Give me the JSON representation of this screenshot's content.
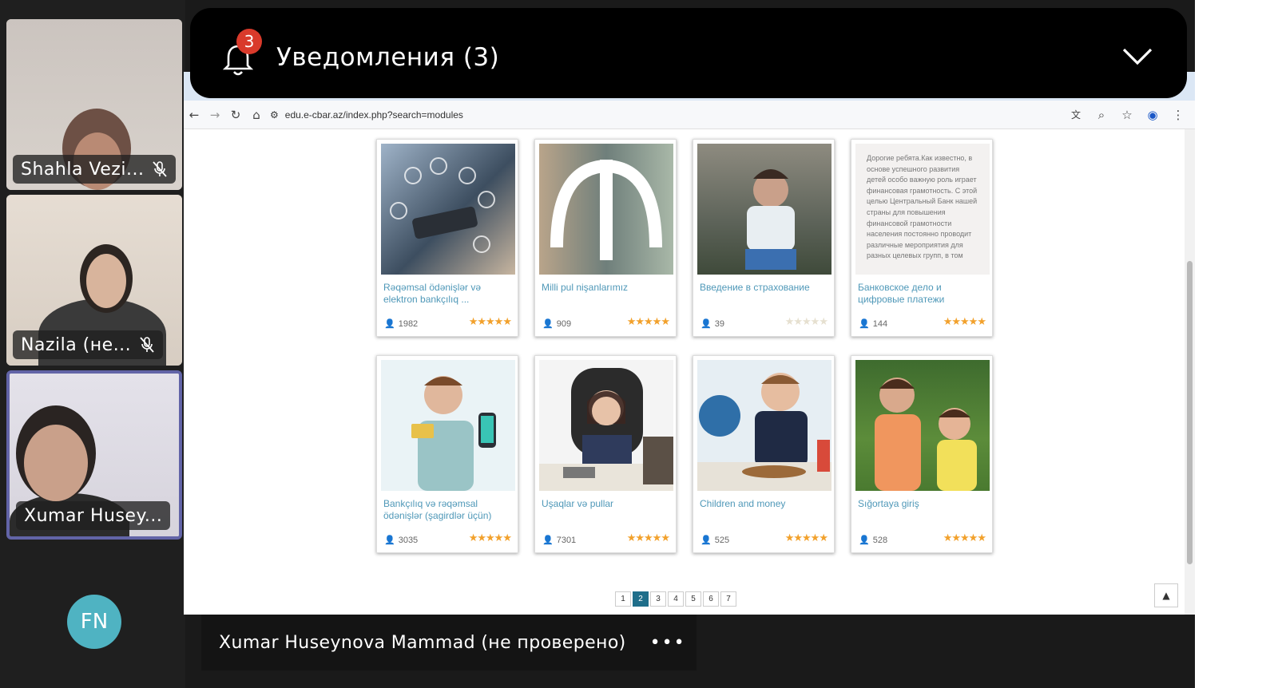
{
  "participants": [
    {
      "name": "Shahla Vezi...",
      "muted": true
    },
    {
      "name": "Nazila (не...",
      "muted": true
    },
    {
      "name": "Xumar Husey...",
      "muted": false,
      "active": true
    },
    {
      "initials": "FN"
    }
  ],
  "notification": {
    "badge": "3",
    "title": "Уведомления (3)"
  },
  "browser": {
    "url": "edu.e-cbar.az/index.php?search=modules"
  },
  "courses": [
    {
      "title": "Rəqəmsal ödənişlər və elektron bankçılıq ...",
      "count": "1982",
      "rating": 5
    },
    {
      "title": "Milli pul nişanlarımız",
      "count": "909",
      "rating": 5
    },
    {
      "title": "Введение в страхование",
      "count": "39",
      "rating": 0
    },
    {
      "title": "Банковское дело и цифровые платежи",
      "count": "144",
      "rating": 5
    },
    {
      "title": "Bankçılıq və rəqəmsal ödənişlər (şagirdlər üçün)",
      "count": "3035",
      "rating": 5
    },
    {
      "title": "Uşaqlar və pullar",
      "count": "7301",
      "rating": 5
    },
    {
      "title": "Children and money",
      "count": "525",
      "rating": 5
    },
    {
      "title": "Sığortaya giriş",
      "count": "528",
      "rating": 5
    }
  ],
  "card4_text": "Дорогие ребята.Как известно, в основе успешного развития детей особо важную роль играет финансовая грамотность. С этой целью Центральный Банк нашей страны для повышения финансовой грамотности населения постоянно проводит различные мероприятия для разных целевых групп, в том",
  "pagination": {
    "pages": [
      "1",
      "2",
      "3",
      "4",
      "5",
      "6",
      "7"
    ],
    "current": "2"
  },
  "speaker": {
    "name": "Xumar Huseynova Mammad (не проверено)",
    "more": "•••"
  },
  "colors": {
    "accent": "#6264a7",
    "badge": "#d93a2b",
    "link": "#4f98b8",
    "star": "#f2a12c",
    "pager": "#1f6e8a"
  }
}
